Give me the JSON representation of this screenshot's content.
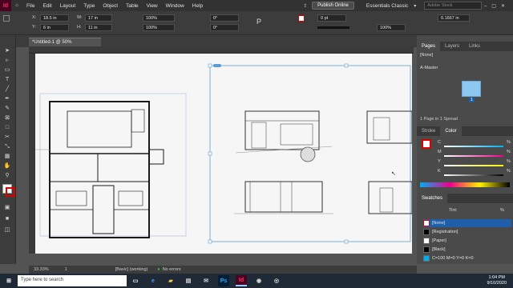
{
  "app": {
    "icon_text": "Id",
    "menus": [
      "File",
      "Edit",
      "Layout",
      "Type",
      "Object",
      "Table",
      "View",
      "Window",
      "Help"
    ],
    "publish_label": "Publish Online",
    "workspace": "Essentials Classic",
    "search_placeholder": "Adobe Stock"
  },
  "control": {
    "x_label": "X:",
    "x_value": "18.5 in",
    "y_label": "Y:",
    "y_value": "6 in",
    "w_label": "W:",
    "w_value": "17 in",
    "h_label": "H:",
    "h_value": "11 in",
    "scale_x": "100%",
    "scale_y": "100%",
    "rotate": "0°",
    "shear": "0°",
    "stroke_weight": "0 pt",
    "opacity": "100%",
    "ref_value": "0.1667 in"
  },
  "document": {
    "tab_title": "*Untitled-1 @ 50%"
  },
  "pages_panel": {
    "tabs": [
      "Pages",
      "Layers",
      "Links"
    ],
    "none_label": "[None]",
    "master_label": "A-Master",
    "spread_info": "1 Page in 1 Spread",
    "page_number": "1"
  },
  "color_panel": {
    "tabs": [
      "Stroke",
      "Color"
    ],
    "channels": [
      {
        "name": "C",
        "value": "%"
      },
      {
        "name": "M",
        "value": "%"
      },
      {
        "name": "Y",
        "value": "%"
      },
      {
        "name": "K",
        "value": "%"
      }
    ]
  },
  "swatches_panel": {
    "title": "Swatches",
    "tint_label": "Tint:",
    "tint_unit": "%",
    "items": [
      {
        "name": "[None]",
        "color": "#ffffff"
      },
      {
        "name": "[Registration]",
        "color": "#000000"
      },
      {
        "name": "[Paper]",
        "color": "#ffffff"
      },
      {
        "name": "[Black]",
        "color": "#000000"
      },
      {
        "name": "C=100 M=0 Y=0 K=0",
        "color": "#00aeef"
      }
    ]
  },
  "status": {
    "zoom": "33.33%",
    "page": "1",
    "style": "[Basic] (working)",
    "errors": "No errors"
  },
  "taskbar": {
    "search_placeholder": "Type here to search",
    "time": "1:04 PM",
    "date": "9/10/2020",
    "apps": [
      "Ps",
      "Id"
    ]
  },
  "colors": {
    "accent": "#ff3366",
    "selection": "#5b9bd5",
    "taskbar": "#1f2a36"
  }
}
